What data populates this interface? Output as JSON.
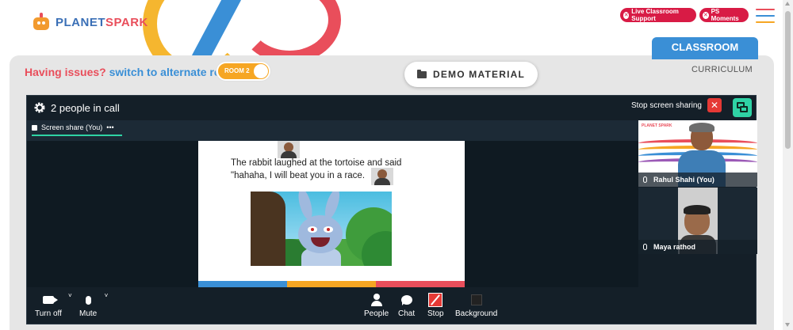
{
  "brand": {
    "logo_part1": "PLANET",
    "logo_part2": "SPARK"
  },
  "header": {
    "live_support_label": "Live Classroom Support",
    "ps_moments_label": "PS Moments",
    "menu_colors": [
      "#e94e5b",
      "#3a8fd6",
      "#f6a623"
    ]
  },
  "tabs": {
    "classroom": "CLASSROOM",
    "curriculum": "CURRICULUM"
  },
  "issue_bar": {
    "prefix": "Having issues?",
    "link": "switch to alternate room",
    "room_toggle_label": "ROOM 2"
  },
  "demo_material": {
    "label": "DEMO MATERIAL"
  },
  "meeting": {
    "people_count_label": "2 people in call",
    "stop_sharing_label": "Stop screen sharing",
    "stop_sharing_close": "✕",
    "share_tab_label": "Screen share (You)",
    "share_tab_more": "•••",
    "slide": {
      "text_line1": "The rabbit laughed at the tortoise and said",
      "text_line2": "\"hahaha, I will beat you in a race."
    },
    "slide_bar_colors": [
      "#3a8fd6",
      "#f6a623",
      "#e94e5b"
    ],
    "participants": [
      {
        "name": "Rahul Shahi (You)"
      },
      {
        "name": "Maya rathod"
      }
    ],
    "tile_logo": "PLANET SPARK",
    "toolbar": {
      "camera_label": "Turn off",
      "mute_label": "Mute",
      "people_label": "People",
      "chat_label": "Chat",
      "stop_label": "Stop",
      "background_label": "Background",
      "caret": "˅"
    }
  },
  "colors": {
    "accent_blue": "#3a8fd6",
    "accent_red": "#e94e5b",
    "accent_orange": "#f6a623",
    "meeting_bg": "#141f28",
    "teal": "#2fd3a5"
  }
}
